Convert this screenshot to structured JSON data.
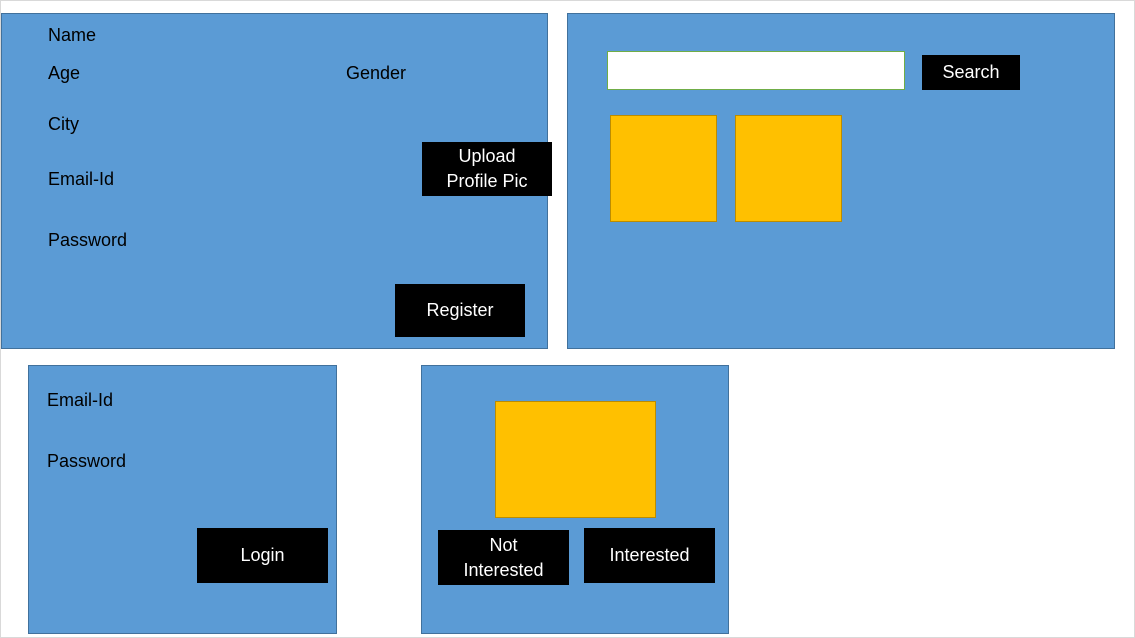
{
  "register": {
    "name_label": "Name",
    "age_label": "Age",
    "gender_label": "Gender",
    "city_label": "City",
    "email_label": "Email-Id",
    "password_label": "Password",
    "upload_label": "Upload\nProfile Pic",
    "register_label": "Register"
  },
  "search": {
    "input_value": "",
    "button_label": "Search",
    "results_count_shown": 2
  },
  "login": {
    "email_label": "Email-Id",
    "password_label": "Password",
    "login_label": "Login"
  },
  "match": {
    "not_interested_label": "Not\nInterested",
    "interested_label": "Interested"
  },
  "colors": {
    "panel": "#5b9bd5",
    "panel_border": "#41719c",
    "button": "#000000",
    "button_text": "#ffffff",
    "tile": "#ffc000",
    "search_border": "#70ad47"
  }
}
